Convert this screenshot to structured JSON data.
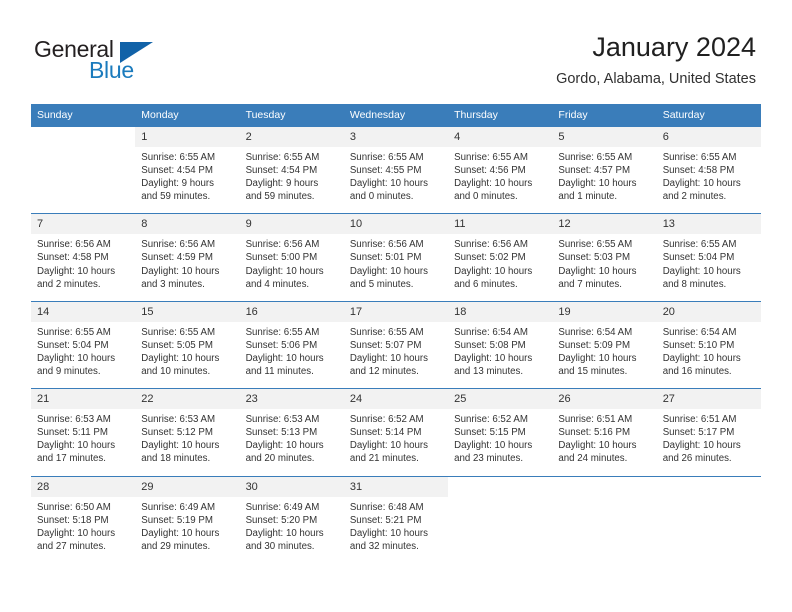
{
  "brand": {
    "name_part1": "General",
    "name_part2": "Blue",
    "triangle_icon": "blue-triangle-logo-mark",
    "colors": {
      "general_text": "#231f20",
      "blue_text": "#1b7bbd",
      "triangle": "#1162a8"
    }
  },
  "header": {
    "title": "January 2024",
    "subtitle": "Gordo, Alabama, United States"
  },
  "theme": {
    "header_row_bg": "#3a7dba",
    "daynum_bg": "#f2f2f2",
    "cell_bg": "#ffffff"
  },
  "calendar": {
    "weekday_headers": [
      "Sunday",
      "Monday",
      "Tuesday",
      "Wednesday",
      "Thursday",
      "Friday",
      "Saturday"
    ],
    "weeks": [
      [
        {
          "day": "",
          "sunrise": "",
          "sunset": "",
          "daylight_line1": "",
          "daylight_line2": "",
          "empty": true
        },
        {
          "day": "1",
          "sunrise": "Sunrise: 6:55 AM",
          "sunset": "Sunset: 4:54 PM",
          "daylight_line1": "Daylight: 9 hours",
          "daylight_line2": "and 59 minutes."
        },
        {
          "day": "2",
          "sunrise": "Sunrise: 6:55 AM",
          "sunset": "Sunset: 4:54 PM",
          "daylight_line1": "Daylight: 9 hours",
          "daylight_line2": "and 59 minutes."
        },
        {
          "day": "3",
          "sunrise": "Sunrise: 6:55 AM",
          "sunset": "Sunset: 4:55 PM",
          "daylight_line1": "Daylight: 10 hours",
          "daylight_line2": "and 0 minutes."
        },
        {
          "day": "4",
          "sunrise": "Sunrise: 6:55 AM",
          "sunset": "Sunset: 4:56 PM",
          "daylight_line1": "Daylight: 10 hours",
          "daylight_line2": "and 0 minutes."
        },
        {
          "day": "5",
          "sunrise": "Sunrise: 6:55 AM",
          "sunset": "Sunset: 4:57 PM",
          "daylight_line1": "Daylight: 10 hours",
          "daylight_line2": "and 1 minute."
        },
        {
          "day": "6",
          "sunrise": "Sunrise: 6:55 AM",
          "sunset": "Sunset: 4:58 PM",
          "daylight_line1": "Daylight: 10 hours",
          "daylight_line2": "and 2 minutes."
        }
      ],
      [
        {
          "day": "7",
          "sunrise": "Sunrise: 6:56 AM",
          "sunset": "Sunset: 4:58 PM",
          "daylight_line1": "Daylight: 10 hours",
          "daylight_line2": "and 2 minutes."
        },
        {
          "day": "8",
          "sunrise": "Sunrise: 6:56 AM",
          "sunset": "Sunset: 4:59 PM",
          "daylight_line1": "Daylight: 10 hours",
          "daylight_line2": "and 3 minutes."
        },
        {
          "day": "9",
          "sunrise": "Sunrise: 6:56 AM",
          "sunset": "Sunset: 5:00 PM",
          "daylight_line1": "Daylight: 10 hours",
          "daylight_line2": "and 4 minutes."
        },
        {
          "day": "10",
          "sunrise": "Sunrise: 6:56 AM",
          "sunset": "Sunset: 5:01 PM",
          "daylight_line1": "Daylight: 10 hours",
          "daylight_line2": "and 5 minutes."
        },
        {
          "day": "11",
          "sunrise": "Sunrise: 6:56 AM",
          "sunset": "Sunset: 5:02 PM",
          "daylight_line1": "Daylight: 10 hours",
          "daylight_line2": "and 6 minutes."
        },
        {
          "day": "12",
          "sunrise": "Sunrise: 6:55 AM",
          "sunset": "Sunset: 5:03 PM",
          "daylight_line1": "Daylight: 10 hours",
          "daylight_line2": "and 7 minutes."
        },
        {
          "day": "13",
          "sunrise": "Sunrise: 6:55 AM",
          "sunset": "Sunset: 5:04 PM",
          "daylight_line1": "Daylight: 10 hours",
          "daylight_line2": "and 8 minutes."
        }
      ],
      [
        {
          "day": "14",
          "sunrise": "Sunrise: 6:55 AM",
          "sunset": "Sunset: 5:04 PM",
          "daylight_line1": "Daylight: 10 hours",
          "daylight_line2": "and 9 minutes."
        },
        {
          "day": "15",
          "sunrise": "Sunrise: 6:55 AM",
          "sunset": "Sunset: 5:05 PM",
          "daylight_line1": "Daylight: 10 hours",
          "daylight_line2": "and 10 minutes."
        },
        {
          "day": "16",
          "sunrise": "Sunrise: 6:55 AM",
          "sunset": "Sunset: 5:06 PM",
          "daylight_line1": "Daylight: 10 hours",
          "daylight_line2": "and 11 minutes."
        },
        {
          "day": "17",
          "sunrise": "Sunrise: 6:55 AM",
          "sunset": "Sunset: 5:07 PM",
          "daylight_line1": "Daylight: 10 hours",
          "daylight_line2": "and 12 minutes."
        },
        {
          "day": "18",
          "sunrise": "Sunrise: 6:54 AM",
          "sunset": "Sunset: 5:08 PM",
          "daylight_line1": "Daylight: 10 hours",
          "daylight_line2": "and 13 minutes."
        },
        {
          "day": "19",
          "sunrise": "Sunrise: 6:54 AM",
          "sunset": "Sunset: 5:09 PM",
          "daylight_line1": "Daylight: 10 hours",
          "daylight_line2": "and 15 minutes."
        },
        {
          "day": "20",
          "sunrise": "Sunrise: 6:54 AM",
          "sunset": "Sunset: 5:10 PM",
          "daylight_line1": "Daylight: 10 hours",
          "daylight_line2": "and 16 minutes."
        }
      ],
      [
        {
          "day": "21",
          "sunrise": "Sunrise: 6:53 AM",
          "sunset": "Sunset: 5:11 PM",
          "daylight_line1": "Daylight: 10 hours",
          "daylight_line2": "and 17 minutes."
        },
        {
          "day": "22",
          "sunrise": "Sunrise: 6:53 AM",
          "sunset": "Sunset: 5:12 PM",
          "daylight_line1": "Daylight: 10 hours",
          "daylight_line2": "and 18 minutes."
        },
        {
          "day": "23",
          "sunrise": "Sunrise: 6:53 AM",
          "sunset": "Sunset: 5:13 PM",
          "daylight_line1": "Daylight: 10 hours",
          "daylight_line2": "and 20 minutes."
        },
        {
          "day": "24",
          "sunrise": "Sunrise: 6:52 AM",
          "sunset": "Sunset: 5:14 PM",
          "daylight_line1": "Daylight: 10 hours",
          "daylight_line2": "and 21 minutes."
        },
        {
          "day": "25",
          "sunrise": "Sunrise: 6:52 AM",
          "sunset": "Sunset: 5:15 PM",
          "daylight_line1": "Daylight: 10 hours",
          "daylight_line2": "and 23 minutes."
        },
        {
          "day": "26",
          "sunrise": "Sunrise: 6:51 AM",
          "sunset": "Sunset: 5:16 PM",
          "daylight_line1": "Daylight: 10 hours",
          "daylight_line2": "and 24 minutes."
        },
        {
          "day": "27",
          "sunrise": "Sunrise: 6:51 AM",
          "sunset": "Sunset: 5:17 PM",
          "daylight_line1": "Daylight: 10 hours",
          "daylight_line2": "and 26 minutes."
        }
      ],
      [
        {
          "day": "28",
          "sunrise": "Sunrise: 6:50 AM",
          "sunset": "Sunset: 5:18 PM",
          "daylight_line1": "Daylight: 10 hours",
          "daylight_line2": "and 27 minutes."
        },
        {
          "day": "29",
          "sunrise": "Sunrise: 6:49 AM",
          "sunset": "Sunset: 5:19 PM",
          "daylight_line1": "Daylight: 10 hours",
          "daylight_line2": "and 29 minutes."
        },
        {
          "day": "30",
          "sunrise": "Sunrise: 6:49 AM",
          "sunset": "Sunset: 5:20 PM",
          "daylight_line1": "Daylight: 10 hours",
          "daylight_line2": "and 30 minutes."
        },
        {
          "day": "31",
          "sunrise": "Sunrise: 6:48 AM",
          "sunset": "Sunset: 5:21 PM",
          "daylight_line1": "Daylight: 10 hours",
          "daylight_line2": "and 32 minutes."
        },
        {
          "day": "",
          "sunrise": "",
          "sunset": "",
          "daylight_line1": "",
          "daylight_line2": "",
          "empty": true
        },
        {
          "day": "",
          "sunrise": "",
          "sunset": "",
          "daylight_line1": "",
          "daylight_line2": "",
          "empty": true
        },
        {
          "day": "",
          "sunrise": "",
          "sunset": "",
          "daylight_line1": "",
          "daylight_line2": "",
          "empty": true
        }
      ]
    ]
  }
}
